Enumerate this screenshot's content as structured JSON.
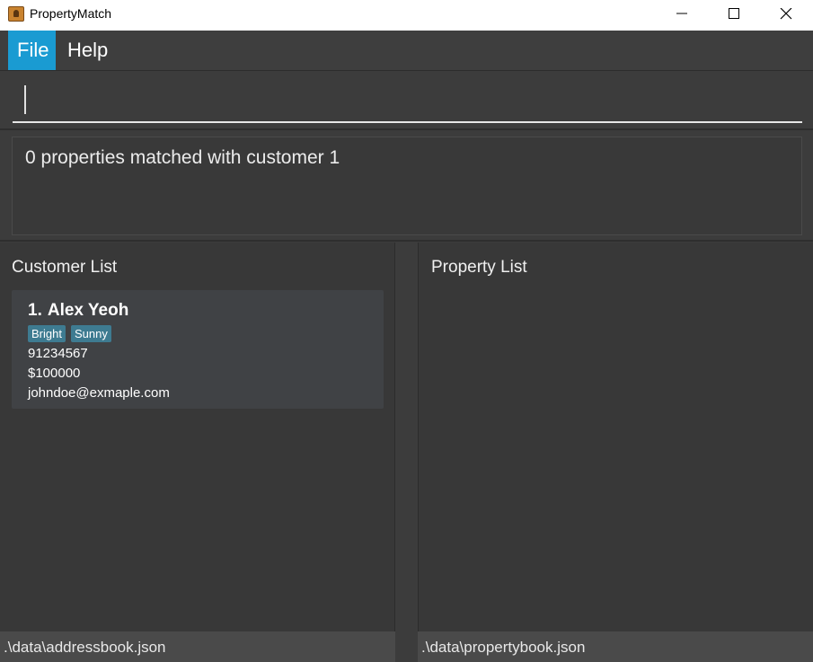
{
  "window": {
    "title": "PropertyMatch",
    "icon": "app-contact-icon"
  },
  "menu": {
    "file": "File",
    "help": "Help"
  },
  "command": {
    "value": ""
  },
  "result": {
    "text": "0 properties matched with customer 1"
  },
  "customer_panel": {
    "title": "Customer List",
    "customers": [
      {
        "index": "1.",
        "name": "Alex Yeoh",
        "tags": [
          "Bright",
          "Sunny"
        ],
        "phone": "91234567",
        "budget": "$100000",
        "email": "johndoe@exmaple.com"
      }
    ]
  },
  "property_panel": {
    "title": "Property List"
  },
  "status": {
    "left": ".\\data\\addressbook.json",
    "right": ".\\data\\propertybook.json"
  },
  "colors": {
    "accent": "#1a9bd2",
    "tag": "#3e7b91",
    "background": "#3c3c3c"
  }
}
